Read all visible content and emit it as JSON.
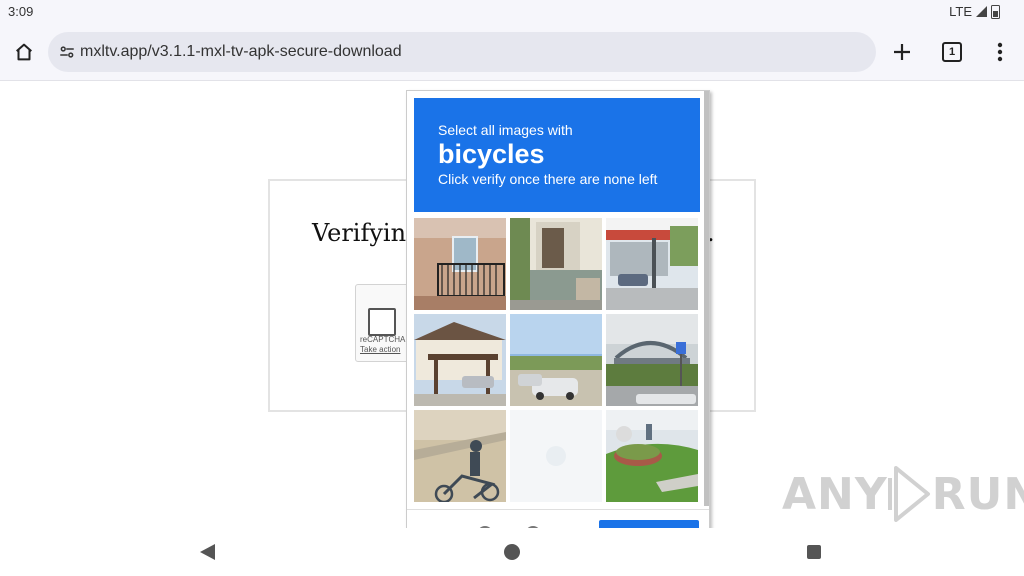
{
  "status_bar": {
    "time": "3:09",
    "network": "LTE"
  },
  "toolbar": {
    "url": "mxltv.app/v3.1.1-mxl-tv-apk-secure-download",
    "tab_count": "1"
  },
  "page": {
    "verifying_text": "Verifyin",
    "trailing_text": "."
  },
  "recaptcha_widget": {
    "label": "reCAPTCHA",
    "link": "Take action"
  },
  "challenge": {
    "instruction": "Select all images with",
    "target": "bicycles",
    "hint": "Click verify once there are none left"
  },
  "watermark": {
    "left": "ANY",
    "right": "RUN"
  },
  "colors": {
    "accent": "#1a73e8",
    "toolbar_bg": "#f6f6fb",
    "urlbar_bg": "#e6e7ef"
  }
}
